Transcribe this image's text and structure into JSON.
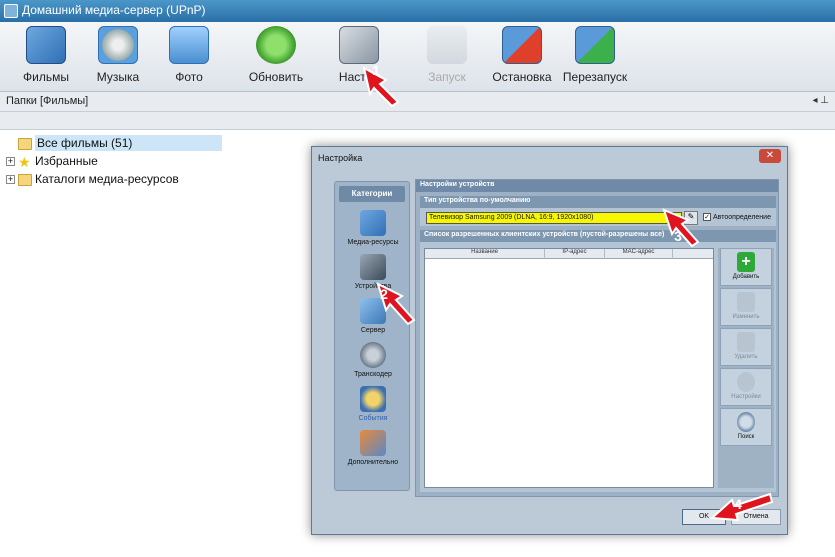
{
  "window": {
    "title": "Домашний медиа-сервер (UPnP)"
  },
  "toolbar": {
    "buttons": [
      {
        "label": "Фильмы",
        "icon": "films-icon",
        "enabled": true
      },
      {
        "label": "Музыка",
        "icon": "music-icon",
        "enabled": true
      },
      {
        "label": "Фото",
        "icon": "photo-icon",
        "enabled": true
      },
      {
        "label": "Обновить",
        "icon": "refresh-icon",
        "enabled": true
      },
      {
        "label": "Настро",
        "icon": "settings-icon",
        "enabled": true
      },
      {
        "label": "Запуск",
        "icon": "start-icon",
        "enabled": false
      },
      {
        "label": "Остановка",
        "icon": "stop-icon",
        "enabled": true
      },
      {
        "label": "Перезапуск",
        "icon": "restart-icon",
        "enabled": true
      }
    ]
  },
  "panel": {
    "title": "Папки [Фильмы]",
    "pin": "◂ ⊥"
  },
  "tree": {
    "items": [
      {
        "label": "Все фильмы (51)",
        "icon": "folder-open-icon",
        "selected": true
      },
      {
        "label": "Избранные",
        "icon": "star-icon",
        "selected": false
      },
      {
        "label": "Каталоги медиа-ресурсов",
        "icon": "folder-icon",
        "selected": false
      }
    ]
  },
  "dialog": {
    "title": "Настройка",
    "close": "✕",
    "categories": {
      "header": "Категории",
      "items": [
        {
          "label": "Медиа-ресурсы",
          "icon": "media-resources-icon",
          "active": false
        },
        {
          "label": "Устройства",
          "icon": "devices-icon",
          "active": false
        },
        {
          "label": "Сервер",
          "icon": "server-icon",
          "active": false
        },
        {
          "label": "Транскодер",
          "icon": "transcoder-icon",
          "active": false
        },
        {
          "label": "События",
          "icon": "events-icon",
          "active": true
        },
        {
          "label": "Дополнительно",
          "icon": "additional-icon",
          "active": false
        }
      ]
    },
    "settings": {
      "header": "Настройки устройств",
      "default_type": {
        "header": "Тип устройства по-умолчанию",
        "value": "Телевизор Samsung 2009 (DLNA, 16:9, 1920x1080)",
        "auto_label": "Автоопределение",
        "auto_checked": "✓"
      },
      "clients": {
        "header": "Список разрешенных клиентских устройств (пустой-разрешены все)",
        "columns": [
          "Название",
          "IP-адрес",
          "MAC-адрес",
          ""
        ],
        "buttons": [
          {
            "label": "Добавить",
            "icon": "add-icon",
            "enabled": true
          },
          {
            "label": "Изменить",
            "icon": "edit-icon",
            "enabled": false
          },
          {
            "label": "Удалить",
            "icon": "delete-icon",
            "enabled": false
          },
          {
            "label": "Настройки",
            "icon": "settings-small-icon",
            "enabled": false
          },
          {
            "label": "Поиск",
            "icon": "search-icon",
            "enabled": true
          }
        ]
      }
    },
    "ok": "OK",
    "cancel": "Отмена"
  },
  "markers": [
    "1",
    "2",
    "3",
    "4"
  ],
  "colors": {
    "marker": "#e0141e",
    "highlight": "#f7f700",
    "selection": "#cde6f7"
  }
}
